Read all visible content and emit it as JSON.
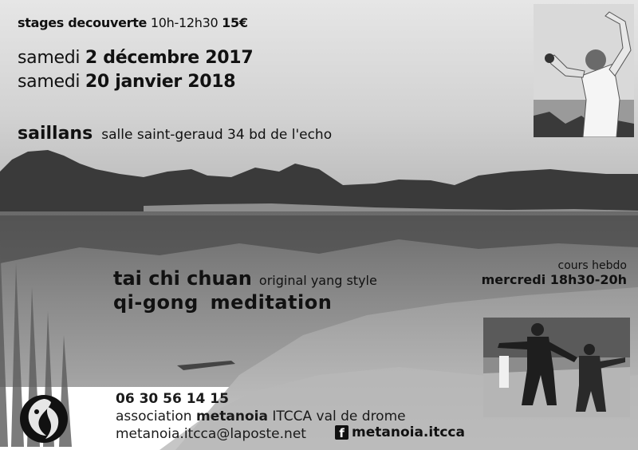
{
  "header": {
    "stages_label": "stages decouverte",
    "stages_time": "10h-12h30",
    "stages_price": "15€",
    "date1_prefix": "samedi",
    "date1_value": "2 décembre 2017",
    "date2_prefix": "samedi",
    "date2_value": "20 janvier 2018"
  },
  "location": {
    "town": "saillans",
    "address": "salle saint-geraud 34 bd de l'echo"
  },
  "practices": {
    "taichi": "tai chi chuan",
    "taichi_style": "original yang style",
    "qigong": "qi-gong  meditation"
  },
  "weekly": {
    "label": "cours hebdo",
    "schedule": "mercredi 18h30-20h"
  },
  "contact": {
    "phone": "06 30 56 14 15",
    "assoc_prefix": "association",
    "assoc_name": "metanoia",
    "assoc_suffix": "ITCCA val de drome",
    "email": "metanoia.itcca@laposte.net",
    "facebook_glyph": "f",
    "facebook": "metanoia.itcca"
  },
  "icons": [
    "facebook-icon",
    "yin-yang-logo"
  ]
}
